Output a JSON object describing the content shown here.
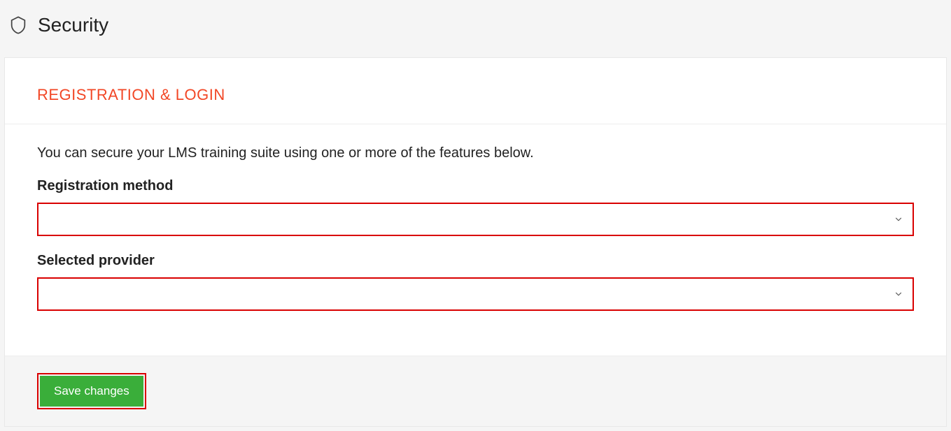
{
  "header": {
    "title": "Security"
  },
  "section": {
    "title": "REGISTRATION & LOGIN",
    "description": "You can secure your LMS training suite using one or more of the features below."
  },
  "fields": {
    "registrationMethod": {
      "label": "Registration method",
      "value": ""
    },
    "selectedProvider": {
      "label": "Selected provider",
      "value": ""
    }
  },
  "actions": {
    "saveLabel": "Save changes"
  }
}
